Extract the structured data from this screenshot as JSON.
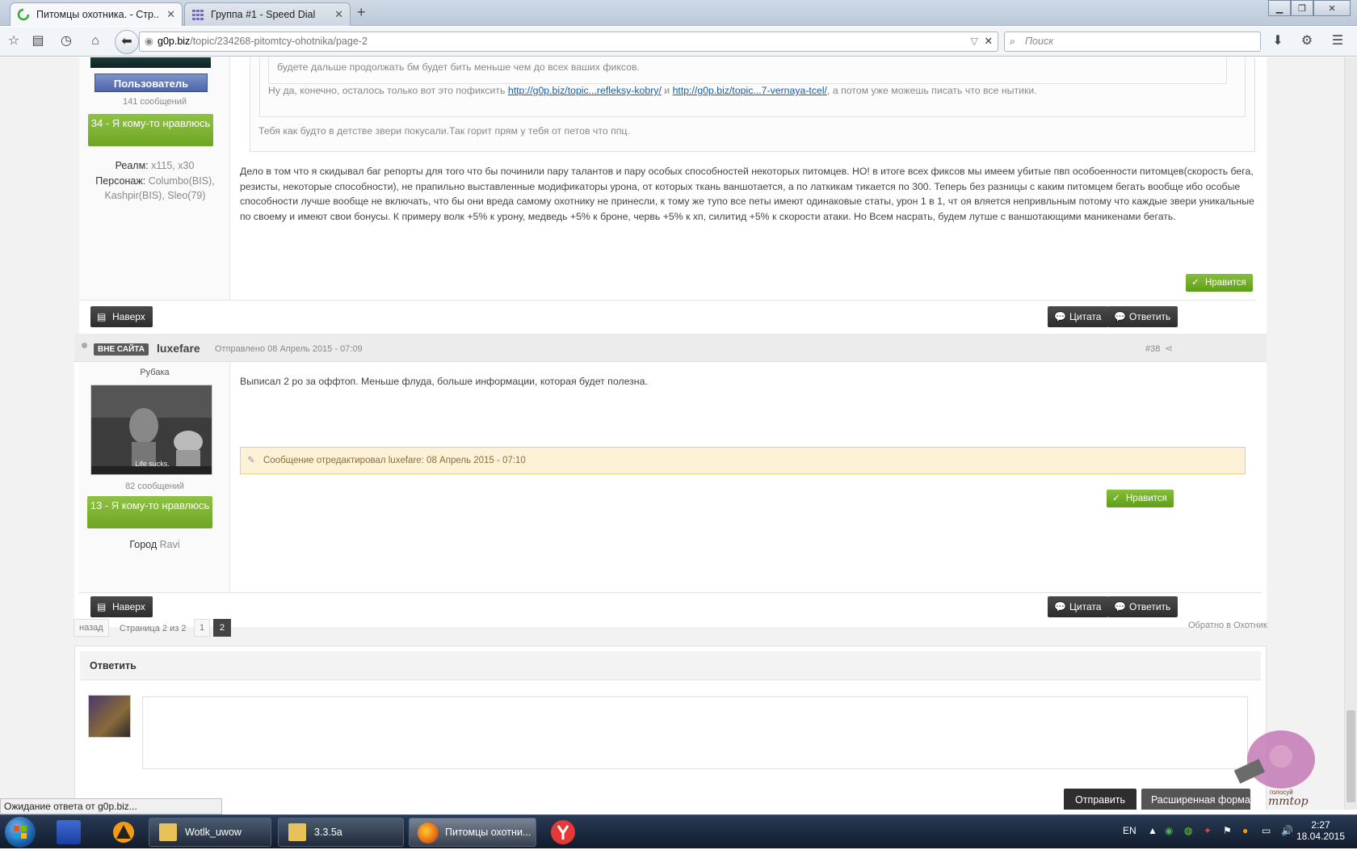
{
  "browser": {
    "tabs": [
      {
        "title": "Питомцы охотника. - Стр..."
      },
      {
        "title": "Группа #1 - Speed Dial"
      }
    ],
    "url_host": "g0p.biz",
    "url_path": "/topic/234268-pitomtcy-ohotnika/page-2",
    "search_placeholder": "Поиск",
    "status_text": "Ожидание ответа от g0p.biz..."
  },
  "post1": {
    "user_group": "Пользователь",
    "post_count": "141 сообщений",
    "rep": "34 - Я кому-то нравлюсь",
    "realm_label": "Реалм:",
    "realm_value": "x115, x30",
    "char_label": "Персонаж:",
    "char_value": "Columbo(BIS), Kashpir(BIS), Sleo(79)",
    "quote_inner_text": "будете дальше продолжать бм будет бить меньше чем до всех ваших фиксов.",
    "quote_line_prefix": "Ну да, конечно, осталось только вот это пофиксить",
    "quote_link1": "http://g0p.biz/topic...refleksy-kobry/",
    "quote_and": "и",
    "quote_link2": "http://g0p.biz/topic...7-vernaya-tcel/",
    "quote_line_suffix": ", а потом уже можешь писать что все нытики.",
    "quote_outer_text": "Тебя как будто в детстве звери покусали.Так горит прям у тебя от петов что ппц.",
    "body": "Дело в том что я скидывал баг репорты для того что бы починили пару талантов и пару особых способностей некоторых питомцев. НО! в итоге всех фиксов мы имеем убитые пвп особоенности питомцев(скорость бега, резисты, некоторые способности), не прапильно выставленные модификаторы урона, от которых ткань ваншотается, а по латкикам тикается по 300. Теперь без разницы с каким питомцем бегать вообще ибо особые способности лучше вообще не включать, что бы они вреда самому охотнику не принесли, к тому же тупо все петы имеют одинаковые статы, урон 1 в 1, чт оя вляется непривльным потому что каждые звери уникальные по своему и имеют свои бонусы. К примеру волк +5% к урону, медведь +5% к броне, червь +5% к хп, силитид +5% к скорости атаки. Но Всем насрать, будем лутше с ваншотающими маникенами бегать.",
    "like": "Нравится",
    "top": "Наверх",
    "quote_btn": "Цитата",
    "reply_btn": "Ответить"
  },
  "post2": {
    "status": "ВНЕ САЙТА",
    "username": "luxefare",
    "date": "Отправлено 08 Апрель 2015 - 07:09",
    "post_num": "#38",
    "rank": "Рубака",
    "avatar_caption": "Life sucks.",
    "post_count": "82 сообщений",
    "rep": "13 - Я кому-то нравлюсь",
    "city_label": "Город",
    "city_value": "Ravi",
    "body": "Выписал 2 ро за оффтоп. Меньше флуда, больше информации, которая будет полезна.",
    "edited": "Сообщение отредактировал luxefare: 08 Апрель 2015 - 07:10",
    "like": "Нравится",
    "top": "Наверх",
    "quote_btn": "Цитата",
    "reply_btn": "Ответить"
  },
  "pagination": {
    "back": "назад",
    "page_info": "Страница 2 из 2",
    "pages": [
      "1",
      "2"
    ],
    "return_link": "Обратно в Охотник"
  },
  "reply": {
    "title": "Ответить",
    "send": "Отправить",
    "advanced": "Расширенная форма"
  },
  "taskbar": {
    "items": [
      "Wotlk_uwow",
      "3.3.5a",
      "Питомцы охотни..."
    ],
    "lang": "EN",
    "time": "2:27",
    "date": "18.04.2015",
    "banner_text": "голосуй"
  }
}
